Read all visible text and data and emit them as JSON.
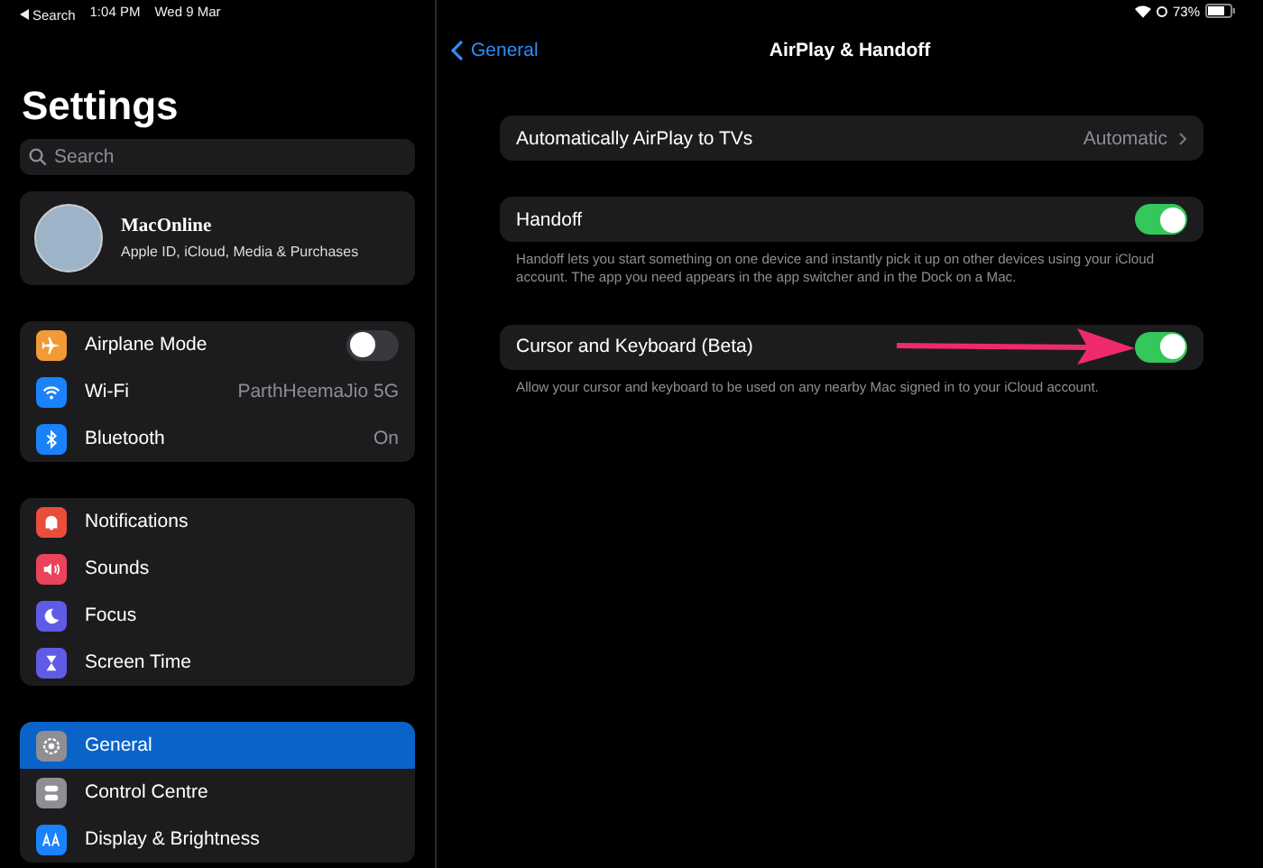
{
  "status_bar": {
    "back_label": "Search",
    "time": "1:04 PM",
    "date": "Wed 9 Mar",
    "battery": "73%"
  },
  "sidebar": {
    "title": "Settings",
    "search": {
      "placeholder": "Search"
    },
    "profile": {
      "name": "MacOnline",
      "subtitle": "Apple ID, iCloud, Media & Purchases"
    },
    "groups": [
      {
        "items": [
          {
            "label": "Airplane Mode",
            "kind": "toggle",
            "on": false,
            "color": "#f19a37",
            "selected": false
          },
          {
            "label": "Wi-Fi",
            "kind": "value",
            "value": "ParthHeemaJio 5G",
            "color": "#1a82fb",
            "selected": false
          },
          {
            "label": "Bluetooth",
            "kind": "value",
            "value": "On",
            "color": "#1a82fb",
            "selected": false
          }
        ]
      },
      {
        "items": [
          {
            "label": "Notifications",
            "kind": "link",
            "color": "#eb4d3d",
            "selected": false
          },
          {
            "label": "Sounds",
            "kind": "link",
            "color": "#eb445a",
            "selected": false
          },
          {
            "label": "Focus",
            "kind": "link",
            "color": "#5e5ce6",
            "selected": false
          },
          {
            "label": "Screen Time",
            "kind": "link",
            "color": "#5e5ce6",
            "selected": false
          }
        ]
      },
      {
        "items": [
          {
            "label": "General",
            "kind": "link",
            "color": "#8e8e93",
            "selected": true
          },
          {
            "label": "Control Centre",
            "kind": "link",
            "color": "#8e8e93",
            "selected": false
          },
          {
            "label": "Display & Brightness",
            "kind": "link",
            "color": "#1a82fb",
            "selected": false
          }
        ]
      }
    ]
  },
  "detail": {
    "back_label": "General",
    "title": "AirPlay & Handoff",
    "sections": [
      {
        "rows": [
          {
            "label": "Automatically AirPlay to TVs",
            "kind": "link",
            "value": "Automatic"
          }
        ]
      },
      {
        "rows": [
          {
            "label": "Handoff",
            "kind": "toggle",
            "on": true
          }
        ],
        "footer": "Handoff lets you start something on one device and instantly pick it up on other devices using your iCloud account. The app you need appears in the app switcher and in the Dock on a Mac."
      },
      {
        "rows": [
          {
            "label": "Cursor and Keyboard (Beta)",
            "kind": "toggle",
            "on": true
          }
        ],
        "footer": "Allow your cursor and keyboard to be used on any nearby Mac signed in to your iCloud account."
      }
    ]
  }
}
